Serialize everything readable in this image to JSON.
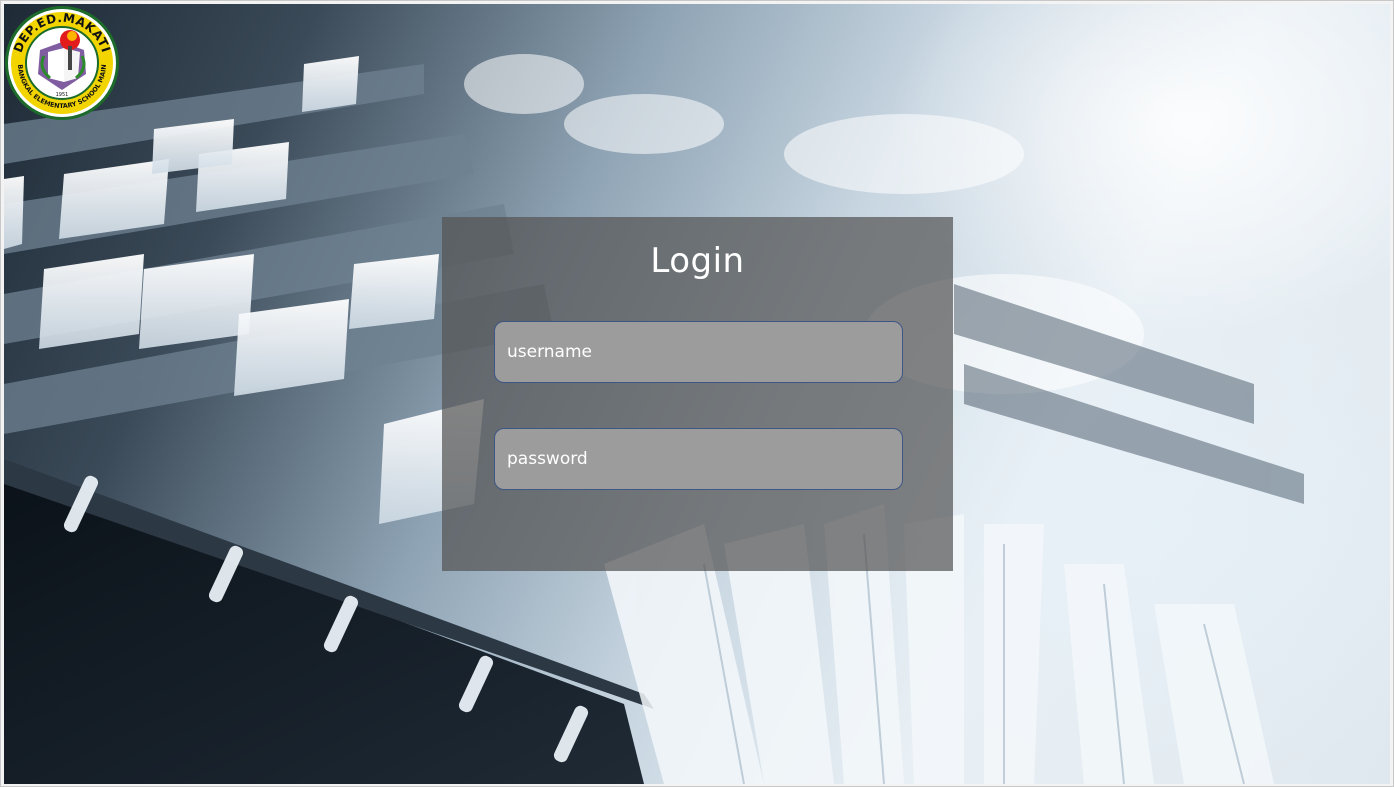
{
  "logo": {
    "top_text": "DEP.ED.MAKATI",
    "bottom_text": "BANGKAL ELEMENTARY SCHOOL MAIN",
    "year": "1951",
    "icon": "school-seal-icon",
    "colors": {
      "ring": "#f1d400",
      "border": "#1c6b2a",
      "text": "#111111"
    }
  },
  "login": {
    "title": "Login",
    "username_placeholder": "username",
    "password_placeholder": "password"
  },
  "theme": {
    "panel_color": "#545454",
    "field_color": "#9c9c9c",
    "field_border": "#3e5685"
  }
}
